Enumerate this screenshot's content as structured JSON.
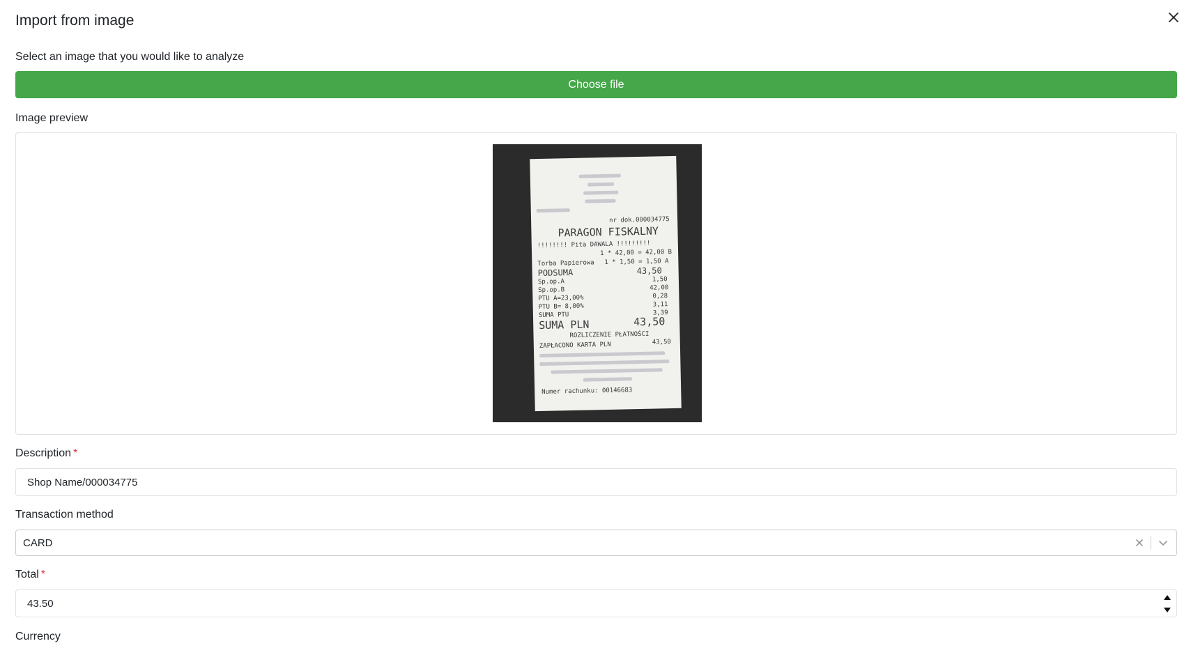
{
  "modal": {
    "title": "Import from image",
    "close_icon": "close-icon"
  },
  "upload": {
    "label": "Select an image that you would like to analyze",
    "button_label": "Choose file",
    "button_color": "#46a74a"
  },
  "preview": {
    "label": "Image preview",
    "receipt": {
      "doc_no": "nr dok.000034775",
      "heading": "PARAGON FISKALNY",
      "item_name": "!!!!!!!! Pita DAWALA !!!!!!!!!",
      "item_calc": "1 * 42,00 = 42,00 B",
      "bag_name": "Torba Papierowa",
      "bag_calc": "1 * 1,50 = 1,50 A",
      "subtotal_label": "PODSUMA",
      "subtotal_value": "43,50",
      "spa_label": "Sp.op.A",
      "spa_value": "1,50",
      "spb_label": "Sp.op.B",
      "spb_value": "42,00",
      "ptua_label": "PTU A=23,00%",
      "ptua_value": "0,28",
      "ptub_label": "PTU B= 8,00%",
      "ptub_value": "3,11",
      "ptusum_label": "SUMA PTU",
      "ptusum_value": "3,39",
      "total_label": "SUMA PLN",
      "total_value": "43,50",
      "settlement": "ROZLICZENIE PŁATNOŚCI",
      "paid_label": "ZAPŁACONO KARTA PLN",
      "paid_value": "43,50",
      "receipt_no": "Numer rachunku: 00146683"
    }
  },
  "description": {
    "label": "Description",
    "required_mark": "*",
    "value": "Shop Name/000034775"
  },
  "transaction_method": {
    "label": "Transaction method",
    "value": "CARD"
  },
  "total": {
    "label": "Total",
    "required_mark": "*",
    "value": "43.50"
  },
  "currency": {
    "label": "Currency"
  }
}
